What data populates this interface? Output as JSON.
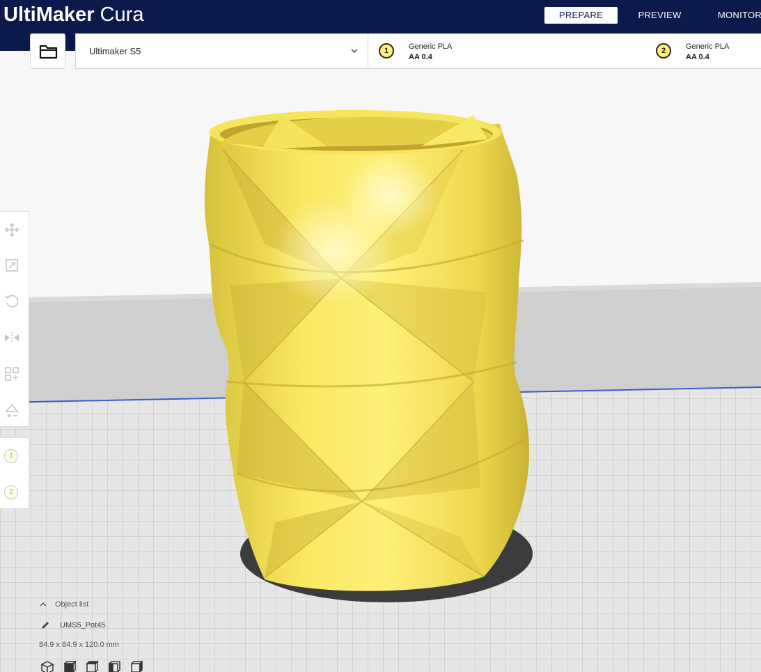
{
  "app": {
    "brand_bold": "UltiMaker",
    "brand_light": " Cura"
  },
  "stages": [
    {
      "label": "PREPARE",
      "active": true
    },
    {
      "label": "PREVIEW",
      "active": false
    },
    {
      "label": "MONITOR",
      "active": false
    }
  ],
  "toolbar": {
    "open_file_icon": "folder-icon",
    "machine": "Ultimaker S5",
    "extruders": [
      {
        "number": "1",
        "material": "Generic PLA",
        "nozzle": "AA 0.4"
      },
      {
        "number": "2",
        "material": "Generic PLA",
        "nozzle": "AA 0.4"
      }
    ]
  },
  "tools": [
    "move-icon",
    "scale-icon",
    "rotate-icon",
    "mirror-icon",
    "per-model-settings-icon",
    "support-blocker-icon"
  ],
  "extruder_selector": [
    "1",
    "2"
  ],
  "object_list": {
    "header": "Object list",
    "object_name": "UMS5_Pot45",
    "dimensions": "84.9 x 84.9 x 120.0 mm"
  },
  "view_buttons": [
    "3d-view-icon",
    "front-view-icon",
    "top-view-icon",
    "left-view-icon",
    "right-view-icon"
  ],
  "colors": {
    "header_bg": "#0c1a4b",
    "model_yellow": "#f7e64f",
    "extruder_badge": "#fff27a"
  }
}
